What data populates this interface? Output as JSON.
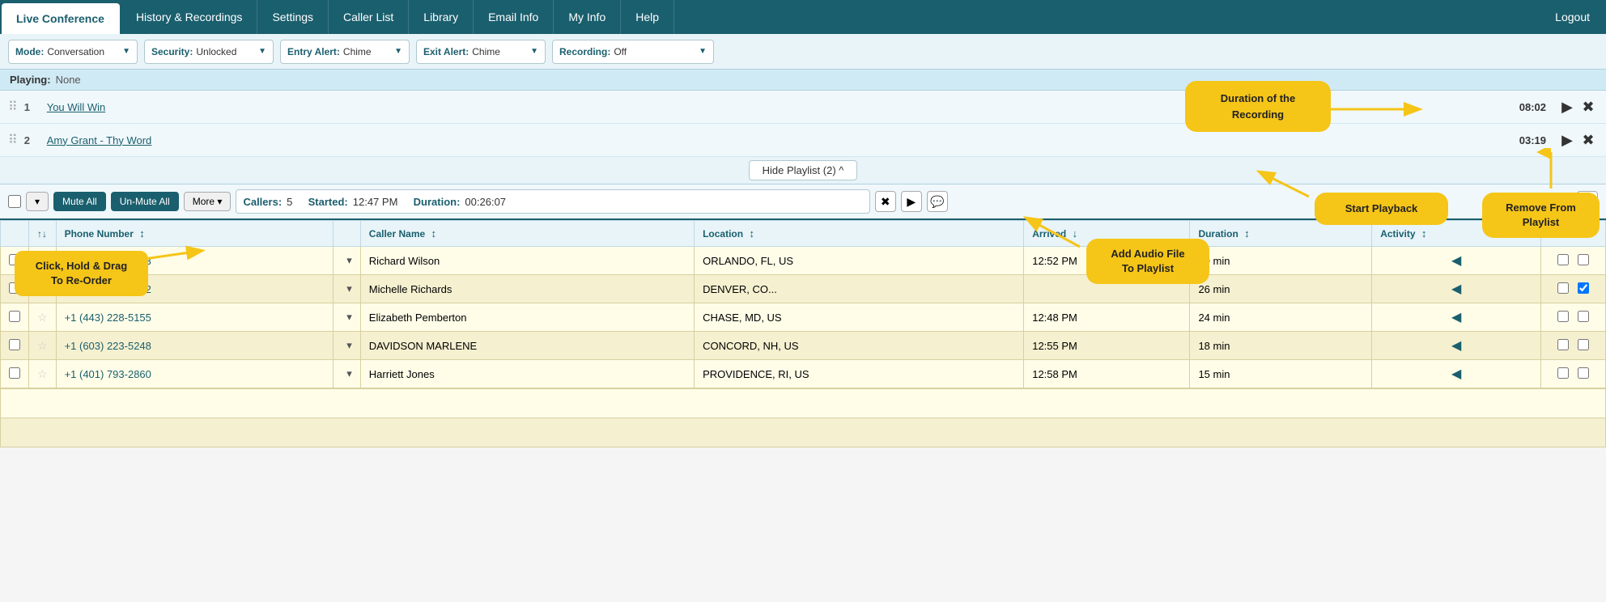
{
  "nav": {
    "items": [
      {
        "label": "Live Conference",
        "active": true
      },
      {
        "label": "History & Recordings",
        "active": false
      },
      {
        "label": "Settings",
        "active": false
      },
      {
        "label": "Caller List",
        "active": false
      },
      {
        "label": "Library",
        "active": false
      },
      {
        "label": "Email Info",
        "active": false
      },
      {
        "label": "My Info",
        "active": false
      },
      {
        "label": "Help",
        "active": false
      }
    ],
    "logout_label": "Logout"
  },
  "controls": {
    "mode_label": "Mode:",
    "mode_value": "Conversation",
    "security_label": "Security:",
    "security_value": "Unlocked",
    "entry_alert_label": "Entry Alert:",
    "entry_alert_value": "Chime",
    "exit_alert_label": "Exit Alert:",
    "exit_alert_value": "Chime",
    "recording_label": "Recording:",
    "recording_value": "Off"
  },
  "playing": {
    "label": "Playing:",
    "value": "None"
  },
  "playlist": {
    "items": [
      {
        "num": 1,
        "title": "You Will Win",
        "duration": "08:02"
      },
      {
        "num": 2,
        "title": "Amy Grant - Thy Word",
        "duration": "03:19"
      }
    ],
    "hide_label": "Hide Playlist (2) ^"
  },
  "toolbar": {
    "mute_all": "Mute All",
    "un_mute_all": "Un-Mute All",
    "more_label": "More ▾",
    "callers_label": "Callers:",
    "callers_count": "5",
    "started_label": "Started:",
    "started_value": "12:47 PM",
    "duration_label": "Duration:",
    "duration_value": "00:26:07"
  },
  "table": {
    "headers": [
      "",
      "",
      "Phone Number",
      "",
      "Caller Name",
      "Location",
      "Arrived",
      "Duration",
      "Activity",
      ""
    ],
    "rows": [
      {
        "checked": false,
        "starred": false,
        "phone": "+1 (407) 912-4303",
        "name": "Richard Wilson",
        "location": "ORLANDO, FL, US",
        "arrived": "12:52 PM",
        "duration": "20 min",
        "activity": true,
        "check1": false,
        "check2": false
      },
      {
        "checked": false,
        "starred": false,
        "phone": "+1 (720) 292-6632",
        "name": "Michelle Richards",
        "location": "DENVER, CO...",
        "arrived": "",
        "duration": "26 min",
        "activity": true,
        "check1": false,
        "check2": true
      },
      {
        "checked": false,
        "starred": false,
        "phone": "+1 (443) 228-5155",
        "name": "Elizabeth Pemberton",
        "location": "CHASE, MD, US",
        "arrived": "12:48 PM",
        "duration": "24 min",
        "activity": true,
        "check1": false,
        "check2": false
      },
      {
        "checked": false,
        "starred": false,
        "phone": "+1 (603) 223-5248",
        "name": "DAVIDSON MARLENE",
        "location": "CONCORD, NH, US",
        "arrived": "12:55 PM",
        "duration": "18 min",
        "activity": true,
        "check1": false,
        "check2": false
      },
      {
        "checked": false,
        "starred": false,
        "phone": "+1 (401) 793-2860",
        "name": "Harriett Jones",
        "location": "PROVIDENCE, RI, US",
        "arrived": "12:58 PM",
        "duration": "15 min",
        "activity": true,
        "check1": false,
        "check2": false
      }
    ]
  },
  "callouts": {
    "drag_reorder": "Click, Hold & Drag\nTo Re-Order",
    "duration_recording": "Duration of the\nRecording",
    "start_playback": "Start Playback",
    "remove_from_playlist": "Remove From\nPlaylist",
    "add_audio_file": "Add Audio File\nTo Playlist"
  }
}
